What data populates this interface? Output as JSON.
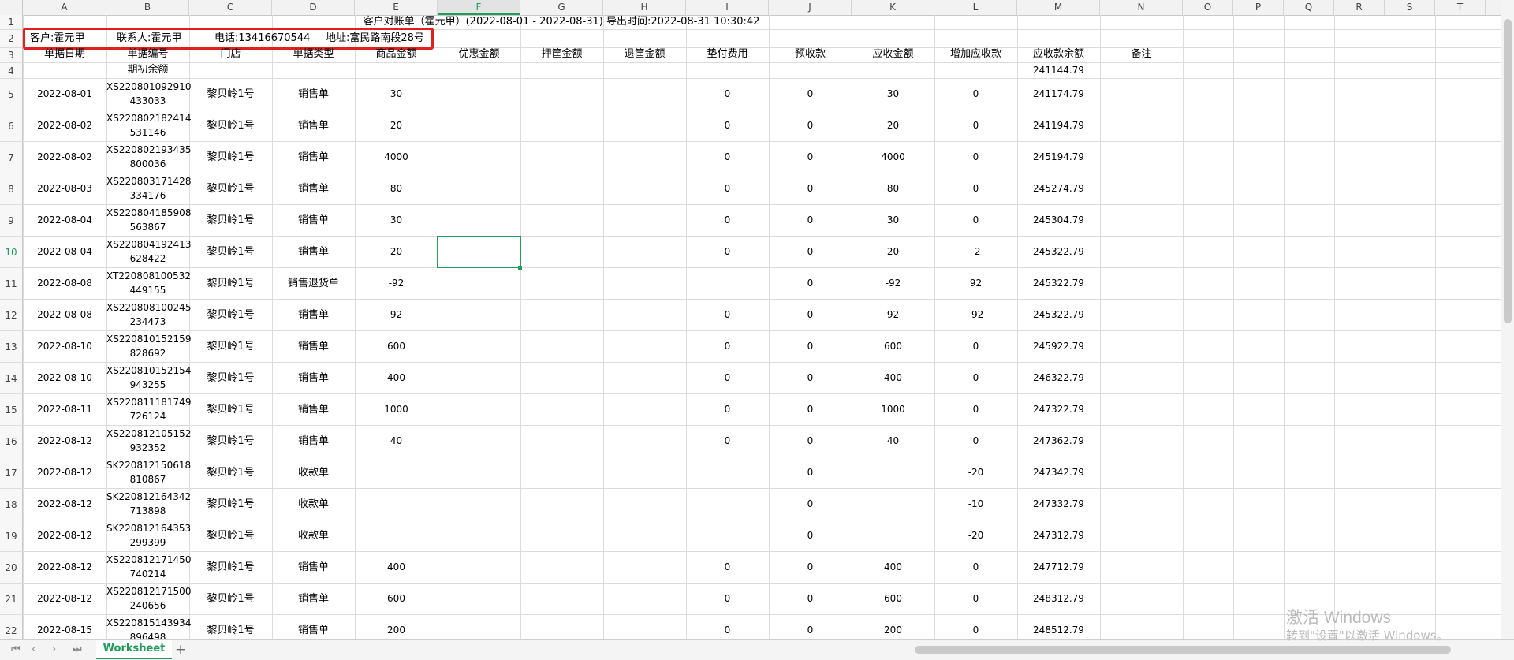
{
  "columns": [
    "A",
    "B",
    "C",
    "D",
    "E",
    "F",
    "G",
    "H",
    "I",
    "J",
    "K",
    "L",
    "M",
    "N",
    "O",
    "P",
    "Q",
    "R",
    "S",
    "T"
  ],
  "selected_column": "F",
  "selected_row": "10",
  "title_row": "客户对账单（霍元甲）(2022-08-01 - 2022-08-31)  导出时间:2022-08-31 10:30:42",
  "info_row": {
    "customer": "客户:霍元甲",
    "contact": "联系人:霍元甲",
    "phone": "电话:13416670544",
    "address": "地址:富民路南段28号"
  },
  "headers": [
    "单据日期",
    "单据编号",
    "门店",
    "单据类型",
    "商品金额",
    "优惠金额",
    "押筐金额",
    "退筐金额",
    "垫付费用",
    "预收款",
    "应收金额",
    "增加应收款",
    "应收款余额",
    "备注"
  ],
  "opening": {
    "label": "期初余额",
    "balance": "241144.79"
  },
  "rows": [
    {
      "num": "5",
      "date": "2022-08-01",
      "code1": "XS220801092910",
      "code2": "433033",
      "store": "黎贝岭1号",
      "type": "销售单",
      "amount": "30",
      "adv": "0",
      "pre": "0",
      "recv": "30",
      "add": "0",
      "bal": "241174.79"
    },
    {
      "num": "6",
      "date": "2022-08-02",
      "code1": "XS220802182414",
      "code2": "531146",
      "store": "黎贝岭1号",
      "type": "销售单",
      "amount": "20",
      "adv": "0",
      "pre": "0",
      "recv": "20",
      "add": "0",
      "bal": "241194.79"
    },
    {
      "num": "7",
      "date": "2022-08-02",
      "code1": "XS220802193435",
      "code2": "800036",
      "store": "黎贝岭1号",
      "type": "销售单",
      "amount": "4000",
      "adv": "0",
      "pre": "0",
      "recv": "4000",
      "add": "0",
      "bal": "245194.79"
    },
    {
      "num": "8",
      "date": "2022-08-03",
      "code1": "XS220803171428",
      "code2": "334176",
      "store": "黎贝岭1号",
      "type": "销售单",
      "amount": "80",
      "adv": "0",
      "pre": "0",
      "recv": "80",
      "add": "0",
      "bal": "245274.79"
    },
    {
      "num": "9",
      "date": "2022-08-04",
      "code1": "XS220804185908",
      "code2": "563867",
      "store": "黎贝岭1号",
      "type": "销售单",
      "amount": "30",
      "adv": "0",
      "pre": "0",
      "recv": "30",
      "add": "0",
      "bal": "245304.79"
    },
    {
      "num": "10",
      "date": "2022-08-04",
      "code1": "XS220804192413",
      "code2": "628422",
      "store": "黎贝岭1号",
      "type": "销售单",
      "amount": "20",
      "adv": "0",
      "pre": "0",
      "recv": "20",
      "add": "-2",
      "bal": "245322.79"
    },
    {
      "num": "11",
      "date": "2022-08-08",
      "code1": "XT220808100532",
      "code2": "449155",
      "store": "黎贝岭1号",
      "type": "销售退货单",
      "amount": "-92",
      "adv": "",
      "pre": "0",
      "recv": "-92",
      "add": "92",
      "bal": "245322.79"
    },
    {
      "num": "12",
      "date": "2022-08-08",
      "code1": "XS220808100245",
      "code2": "234473",
      "store": "黎贝岭1号",
      "type": "销售单",
      "amount": "92",
      "adv": "0",
      "pre": "0",
      "recv": "92",
      "add": "-92",
      "bal": "245322.79"
    },
    {
      "num": "13",
      "date": "2022-08-10",
      "code1": "XS220810152159",
      "code2": "828692",
      "store": "黎贝岭1号",
      "type": "销售单",
      "amount": "600",
      "adv": "0",
      "pre": "0",
      "recv": "600",
      "add": "0",
      "bal": "245922.79"
    },
    {
      "num": "14",
      "date": "2022-08-10",
      "code1": "XS220810152154",
      "code2": "943255",
      "store": "黎贝岭1号",
      "type": "销售单",
      "amount": "400",
      "adv": "0",
      "pre": "0",
      "recv": "400",
      "add": "0",
      "bal": "246322.79"
    },
    {
      "num": "15",
      "date": "2022-08-11",
      "code1": "XS220811181749",
      "code2": "726124",
      "store": "黎贝岭1号",
      "type": "销售单",
      "amount": "1000",
      "adv": "0",
      "pre": "0",
      "recv": "1000",
      "add": "0",
      "bal": "247322.79"
    },
    {
      "num": "16",
      "date": "2022-08-12",
      "code1": "XS220812105152",
      "code2": "932352",
      "store": "黎贝岭1号",
      "type": "销售单",
      "amount": "40",
      "adv": "0",
      "pre": "0",
      "recv": "40",
      "add": "0",
      "bal": "247362.79"
    },
    {
      "num": "17",
      "date": "2022-08-12",
      "code1": "SK220812150618",
      "code2": "810867",
      "store": "黎贝岭1号",
      "type": "收款单",
      "amount": "",
      "adv": "",
      "pre": "0",
      "recv": "",
      "add": "-20",
      "bal": "247342.79"
    },
    {
      "num": "18",
      "date": "2022-08-12",
      "code1": "SK220812164342",
      "code2": "713898",
      "store": "黎贝岭1号",
      "type": "收款单",
      "amount": "",
      "adv": "",
      "pre": "0",
      "recv": "",
      "add": "-10",
      "bal": "247332.79"
    },
    {
      "num": "19",
      "date": "2022-08-12",
      "code1": "SK220812164353",
      "code2": "299399",
      "store": "黎贝岭1号",
      "type": "收款单",
      "amount": "",
      "adv": "",
      "pre": "0",
      "recv": "",
      "add": "-20",
      "bal": "247312.79"
    },
    {
      "num": "20",
      "date": "2022-08-12",
      "code1": "XS220812171450",
      "code2": "740214",
      "store": "黎贝岭1号",
      "type": "销售单",
      "amount": "400",
      "adv": "0",
      "pre": "0",
      "recv": "400",
      "add": "0",
      "bal": "247712.79"
    },
    {
      "num": "21",
      "date": "2022-08-12",
      "code1": "XS220812171500",
      "code2": "240656",
      "store": "黎贝岭1号",
      "type": "销售单",
      "amount": "600",
      "adv": "0",
      "pre": "0",
      "recv": "600",
      "add": "0",
      "bal": "248312.79"
    },
    {
      "num": "22",
      "date": "2022-08-15",
      "code1": "XS220815143934",
      "code2": "896498",
      "store": "黎贝岭1号",
      "type": "销售单",
      "amount": "200",
      "adv": "0",
      "pre": "0",
      "recv": "200",
      "add": "0",
      "bal": "248512.79"
    }
  ],
  "sheet_tab": "Worksheet",
  "add_tab": "+",
  "watermark": {
    "line1": "激活 Windows",
    "line2": "转到\"设置\"以激活 Windows。"
  },
  "colors": {
    "accent": "#1e9e5a",
    "highlight_box": "#e02020"
  }
}
